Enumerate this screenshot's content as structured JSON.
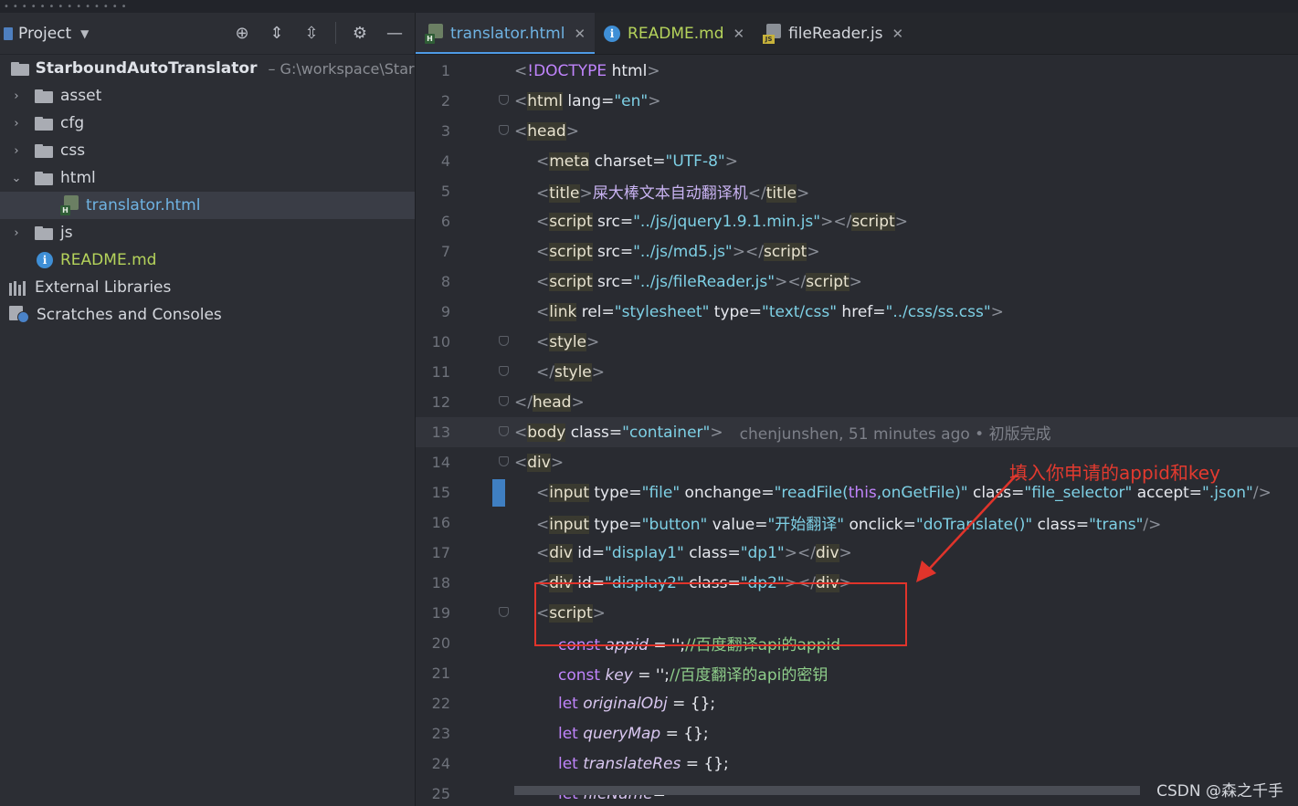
{
  "project_panel": {
    "title": "Project",
    "root": {
      "name": "StarboundAutoTranslator",
      "path": "– G:\\workspace\\StarB"
    },
    "folders": [
      {
        "name": "asset"
      },
      {
        "name": "cfg"
      },
      {
        "name": "css"
      },
      {
        "name": "html"
      },
      {
        "name": "js"
      }
    ],
    "selected_file": "translator.html",
    "readme": "README.md",
    "external_libraries": "External Libraries",
    "scratches": "Scratches and Consoles"
  },
  "tabs": [
    {
      "label": "translator.html",
      "icon": "html-file-icon",
      "active": true
    },
    {
      "label": "README.md",
      "icon": "info-icon",
      "active": false
    },
    {
      "label": "fileReader.js",
      "icon": "js-file-icon",
      "active": false
    }
  ],
  "code_lines": [
    {
      "n": "1",
      "tokens": [
        [
          "br",
          "<"
        ],
        [
          "doct",
          "!DOCTYPE"
        ],
        [
          "plain",
          " html"
        ],
        [
          "br",
          ">"
        ]
      ]
    },
    {
      "n": "2",
      "tokens": [
        [
          "br",
          "<"
        ],
        [
          "tag",
          "html"
        ],
        [
          "attr",
          " lang"
        ],
        [
          "plain",
          "="
        ],
        [
          "str",
          "\"en\""
        ],
        [
          "br",
          ">"
        ]
      ]
    },
    {
      "n": "3",
      "tokens": [
        [
          "br",
          "<"
        ],
        [
          "tag",
          "head"
        ],
        [
          "br",
          ">"
        ]
      ]
    },
    {
      "n": "4",
      "indent": 1,
      "tokens": [
        [
          "br",
          "<"
        ],
        [
          "tag",
          "meta"
        ],
        [
          "attr",
          " charset"
        ],
        [
          "plain",
          "="
        ],
        [
          "str",
          "\"UTF-8\""
        ],
        [
          "br",
          ">"
        ]
      ]
    },
    {
      "n": "5",
      "indent": 1,
      "tokens": [
        [
          "br",
          "<"
        ],
        [
          "tag",
          "title"
        ],
        [
          "br",
          ">"
        ],
        [
          "text",
          "屎大棒文本自动翻译机"
        ],
        [
          "br",
          "</"
        ],
        [
          "tag",
          "title"
        ],
        [
          "br",
          ">"
        ]
      ]
    },
    {
      "n": "6",
      "indent": 1,
      "tokens": [
        [
          "br",
          "<"
        ],
        [
          "tag",
          "script"
        ],
        [
          "attr",
          " src"
        ],
        [
          "plain",
          "="
        ],
        [
          "str",
          "\"../js/jquery1.9.1.min.js\""
        ],
        [
          "br",
          "></"
        ],
        [
          "tag",
          "script"
        ],
        [
          "br",
          ">"
        ]
      ]
    },
    {
      "n": "7",
      "indent": 1,
      "tokens": [
        [
          "br",
          "<"
        ],
        [
          "tag",
          "script"
        ],
        [
          "attr",
          " src"
        ],
        [
          "plain",
          "="
        ],
        [
          "str",
          "\"../js/md5.js\""
        ],
        [
          "br",
          "></"
        ],
        [
          "tag",
          "script"
        ],
        [
          "br",
          ">"
        ]
      ]
    },
    {
      "n": "8",
      "indent": 1,
      "tokens": [
        [
          "br",
          "<"
        ],
        [
          "tag",
          "script"
        ],
        [
          "attr",
          " src"
        ],
        [
          "plain",
          "="
        ],
        [
          "str",
          "\"../js/fileReader.js\""
        ],
        [
          "br",
          "></"
        ],
        [
          "tag",
          "script"
        ],
        [
          "br",
          ">"
        ]
      ]
    },
    {
      "n": "9",
      "indent": 1,
      "tokens": [
        [
          "br",
          "<"
        ],
        [
          "tag",
          "link"
        ],
        [
          "attr",
          " rel"
        ],
        [
          "plain",
          "="
        ],
        [
          "str",
          "\"stylesheet\""
        ],
        [
          "attr",
          " type"
        ],
        [
          "plain",
          "="
        ],
        [
          "str",
          "\"text/css\""
        ],
        [
          "attr",
          " href"
        ],
        [
          "plain",
          "="
        ],
        [
          "str",
          "\"../css/ss.css\""
        ],
        [
          "br",
          ">"
        ]
      ]
    },
    {
      "n": "10",
      "indent": 1,
      "tokens": [
        [
          "br",
          "<"
        ],
        [
          "tag",
          "style"
        ],
        [
          "br",
          ">"
        ]
      ]
    },
    {
      "n": "11",
      "indent": 1,
      "tokens": [
        [
          "br",
          "</"
        ],
        [
          "tag",
          "style"
        ],
        [
          "br",
          ">"
        ]
      ]
    },
    {
      "n": "12",
      "tokens": [
        [
          "br",
          "</"
        ],
        [
          "tag",
          "head"
        ],
        [
          "br",
          ">"
        ]
      ]
    },
    {
      "n": "13",
      "current": true,
      "tokens": [
        [
          "br",
          "<"
        ],
        [
          "tag",
          "body"
        ],
        [
          "attr",
          " class"
        ],
        [
          "plain",
          "="
        ],
        [
          "str",
          "\"container\""
        ],
        [
          "br",
          ">"
        ]
      ],
      "blame": "chenjunshen, 51 minutes ago • 初版完成"
    },
    {
      "n": "14",
      "tokens": [
        [
          "br",
          "<"
        ],
        [
          "tag",
          "div"
        ],
        [
          "br",
          ">"
        ]
      ]
    },
    {
      "n": "15",
      "indent": 1,
      "tokens": [
        [
          "br",
          "<"
        ],
        [
          "tag",
          "input"
        ],
        [
          "attr",
          " type"
        ],
        [
          "plain",
          "="
        ],
        [
          "str",
          "\"file\""
        ],
        [
          "attr",
          " onchange"
        ],
        [
          "plain",
          "="
        ],
        [
          "str",
          "\"readFile("
        ],
        [
          "this",
          "this"
        ],
        [
          "str",
          ",onGetFile)\""
        ],
        [
          "attr",
          " class"
        ],
        [
          "plain",
          "="
        ],
        [
          "str",
          "\"file_selector\""
        ],
        [
          "attr",
          " accept"
        ],
        [
          "plain",
          "="
        ],
        [
          "str",
          "\".json\""
        ],
        [
          "br",
          "/>"
        ]
      ]
    },
    {
      "n": "16",
      "indent": 1,
      "tokens": [
        [
          "br",
          "<"
        ],
        [
          "tag",
          "input"
        ],
        [
          "attr",
          " type"
        ],
        [
          "plain",
          "="
        ],
        [
          "str",
          "\"button\""
        ],
        [
          "attr",
          " value"
        ],
        [
          "plain",
          "="
        ],
        [
          "str",
          "\"开始翻译\""
        ],
        [
          "attr",
          " onclick"
        ],
        [
          "plain",
          "="
        ],
        [
          "str",
          "\"doTranslate()\""
        ],
        [
          "attr",
          " class"
        ],
        [
          "plain",
          "="
        ],
        [
          "str",
          "\"trans\""
        ],
        [
          "br",
          "/>"
        ]
      ]
    },
    {
      "n": "17",
      "indent": 1,
      "tokens": [
        [
          "br",
          "<"
        ],
        [
          "tag",
          "div"
        ],
        [
          "attr",
          " id"
        ],
        [
          "plain",
          "="
        ],
        [
          "str",
          "\"display1\""
        ],
        [
          "attr",
          " class"
        ],
        [
          "plain",
          "="
        ],
        [
          "str",
          "\"dp1\""
        ],
        [
          "br",
          "></"
        ],
        [
          "tag",
          "div"
        ],
        [
          "br",
          ">"
        ]
      ]
    },
    {
      "n": "18",
      "indent": 1,
      "tokens": [
        [
          "br",
          "<"
        ],
        [
          "tag",
          "div"
        ],
        [
          "attr",
          " id"
        ],
        [
          "plain",
          "="
        ],
        [
          "str",
          "\"display2\""
        ],
        [
          "attr",
          " class"
        ],
        [
          "plain",
          "="
        ],
        [
          "str",
          "\"dp2\""
        ],
        [
          "br",
          "></"
        ],
        [
          "tag",
          "div"
        ],
        [
          "br",
          ">"
        ]
      ]
    },
    {
      "n": "19",
      "indent": 1,
      "tokens": [
        [
          "br",
          "<"
        ],
        [
          "tag",
          "script"
        ],
        [
          "br",
          ">"
        ]
      ]
    },
    {
      "n": "20",
      "indent": 2,
      "tokens": [
        [
          "kw",
          "const "
        ],
        [
          "var",
          "appid"
        ],
        [
          "plain",
          " = "
        ],
        [
          "plain",
          "'';"
        ],
        [
          "cmt",
          "//百度翻译api的appid"
        ]
      ]
    },
    {
      "n": "21",
      "indent": 2,
      "tokens": [
        [
          "kw",
          "const "
        ],
        [
          "var",
          "key"
        ],
        [
          "plain",
          " = "
        ],
        [
          "plain",
          "'';"
        ],
        [
          "cmt",
          "//百度翻译的api的密钥"
        ]
      ]
    },
    {
      "n": "22",
      "indent": 2,
      "tokens": [
        [
          "kw",
          "let "
        ],
        [
          "var",
          "originalObj"
        ],
        [
          "plain",
          " = {};"
        ]
      ]
    },
    {
      "n": "23",
      "indent": 2,
      "tokens": [
        [
          "kw",
          "let "
        ],
        [
          "var",
          "queryMap"
        ],
        [
          "plain",
          " = {};"
        ]
      ]
    },
    {
      "n": "24",
      "indent": 2,
      "tokens": [
        [
          "kw",
          "let "
        ],
        [
          "var",
          "translateRes"
        ],
        [
          "plain",
          " = {};"
        ]
      ]
    },
    {
      "n": "25",
      "indent": 2,
      "tokens": [
        [
          "kw",
          "let "
        ],
        [
          "var",
          "fileName"
        ],
        [
          "plain",
          "=''"
        ]
      ]
    }
  ],
  "annotation": "填入你申请的appid和key",
  "watermark": "CSDN @森之千手",
  "colors": {
    "highlight_box": "#e0342b",
    "accent": "#4e9be6",
    "readme": "#b5d35b"
  }
}
